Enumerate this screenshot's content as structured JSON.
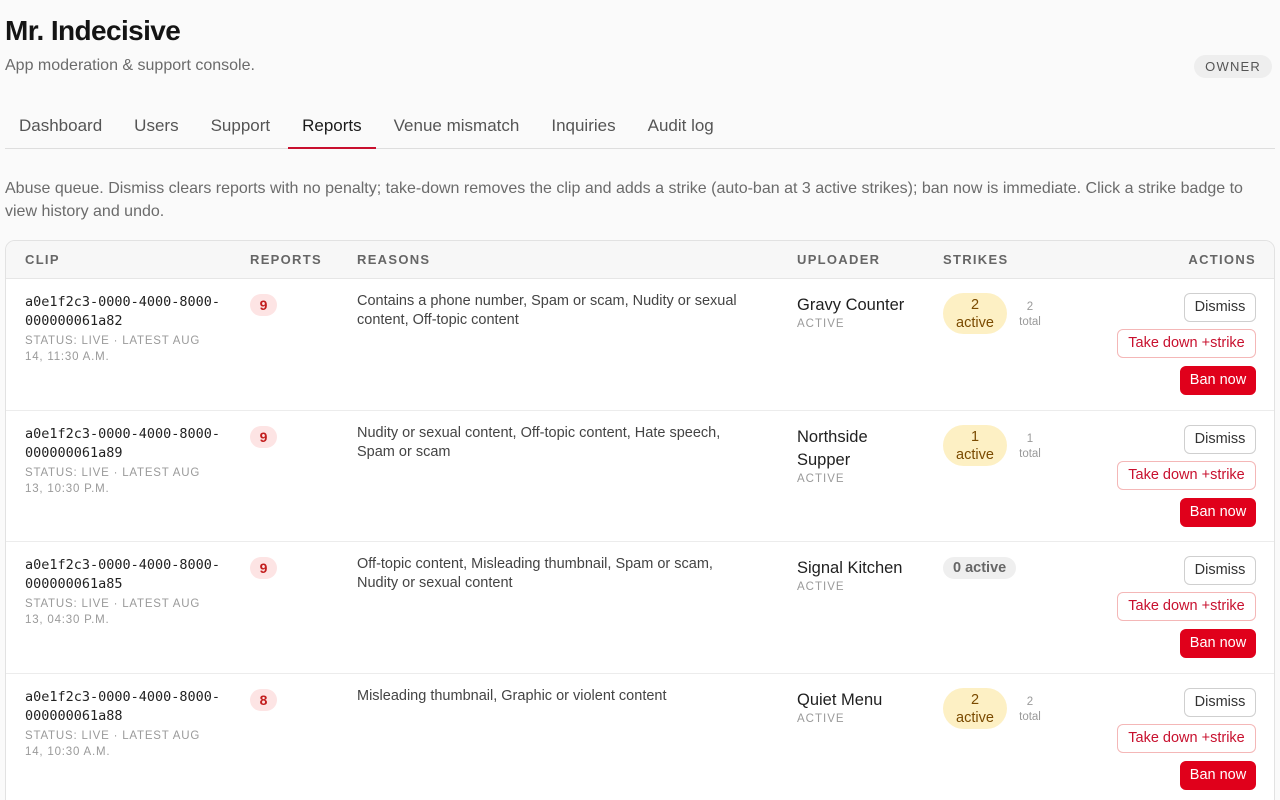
{
  "app": {
    "title": "Mr. Indecisive",
    "subtitle": "App moderation & support console.",
    "role": "OWNER"
  },
  "tabs": [
    {
      "label": "Dashboard",
      "active": false
    },
    {
      "label": "Users",
      "active": false
    },
    {
      "label": "Support",
      "active": false
    },
    {
      "label": "Reports",
      "active": true
    },
    {
      "label": "Venue mismatch",
      "active": false
    },
    {
      "label": "Inquiries",
      "active": false
    },
    {
      "label": "Audit log",
      "active": false
    }
  ],
  "intro": "Abuse queue. Dismiss clears reports with no penalty; take-down removes the clip and adds a strike (auto-ban at 3 active strikes); ban now is immediate. Click a strike badge to view history and undo.",
  "table": {
    "headers": {
      "clip": "CLIP",
      "reports": "REPORTS",
      "reasons": "REASONS",
      "uploader": "UPLOADER",
      "strikes": "STRIKES",
      "actions": "ACTIONS"
    },
    "actions": {
      "dismiss": "Dismiss",
      "takedown": "Take down +strike",
      "ban": "Ban now"
    },
    "rows": [
      {
        "clip_id": "a0e1f2c3-0000-4000-8000-000000061a82",
        "clip_status": "STATUS: LIVE · LATEST AUG 14, 11:30 A.M.",
        "reports": "9",
        "reasons": "Contains a phone number, Spam or scam, Nudity or sexual content, Off-topic content",
        "uploader": "Gravy Counter",
        "uploader_status": "ACTIVE",
        "strikes_active": "2",
        "strikes_active_label": "active",
        "strikes_total": "2",
        "strikes_total_label": "total"
      },
      {
        "clip_id": "a0e1f2c3-0000-4000-8000-000000061a89",
        "clip_status": "STATUS: LIVE · LATEST AUG 13, 10:30 P.M.",
        "reports": "9",
        "reasons": "Nudity or sexual content, Off-topic content, Hate speech, Spam or scam",
        "uploader": "Northside Supper",
        "uploader_status": "ACTIVE",
        "strikes_active": "1",
        "strikes_active_label": "active",
        "strikes_total": "1",
        "strikes_total_label": "total"
      },
      {
        "clip_id": "a0e1f2c3-0000-4000-8000-000000061a85",
        "clip_status": "STATUS: LIVE · LATEST AUG 13, 04:30 P.M.",
        "reports": "9",
        "reasons": "Off-topic content, Misleading thumbnail, Spam or scam, Nudity or sexual content",
        "uploader": "Signal Kitchen",
        "uploader_status": "ACTIVE",
        "strikes_zero_label": "0 active"
      },
      {
        "clip_id": "a0e1f2c3-0000-4000-8000-000000061a88",
        "clip_status": "STATUS: LIVE · LATEST AUG 14, 10:30 A.M.",
        "reports": "8",
        "reasons": "Misleading thumbnail, Graphic or violent content",
        "uploader": "Quiet Menu",
        "uploader_status": "ACTIVE",
        "strikes_active": "2",
        "strikes_active_label": "active",
        "strikes_total": "2",
        "strikes_total_label": "total"
      }
    ]
  },
  "colors": {
    "accent": "#c8102e",
    "danger": "#e0001b",
    "strike_badge_bg": "#fdf0c4",
    "count_badge_bg": "#fde4e4"
  }
}
